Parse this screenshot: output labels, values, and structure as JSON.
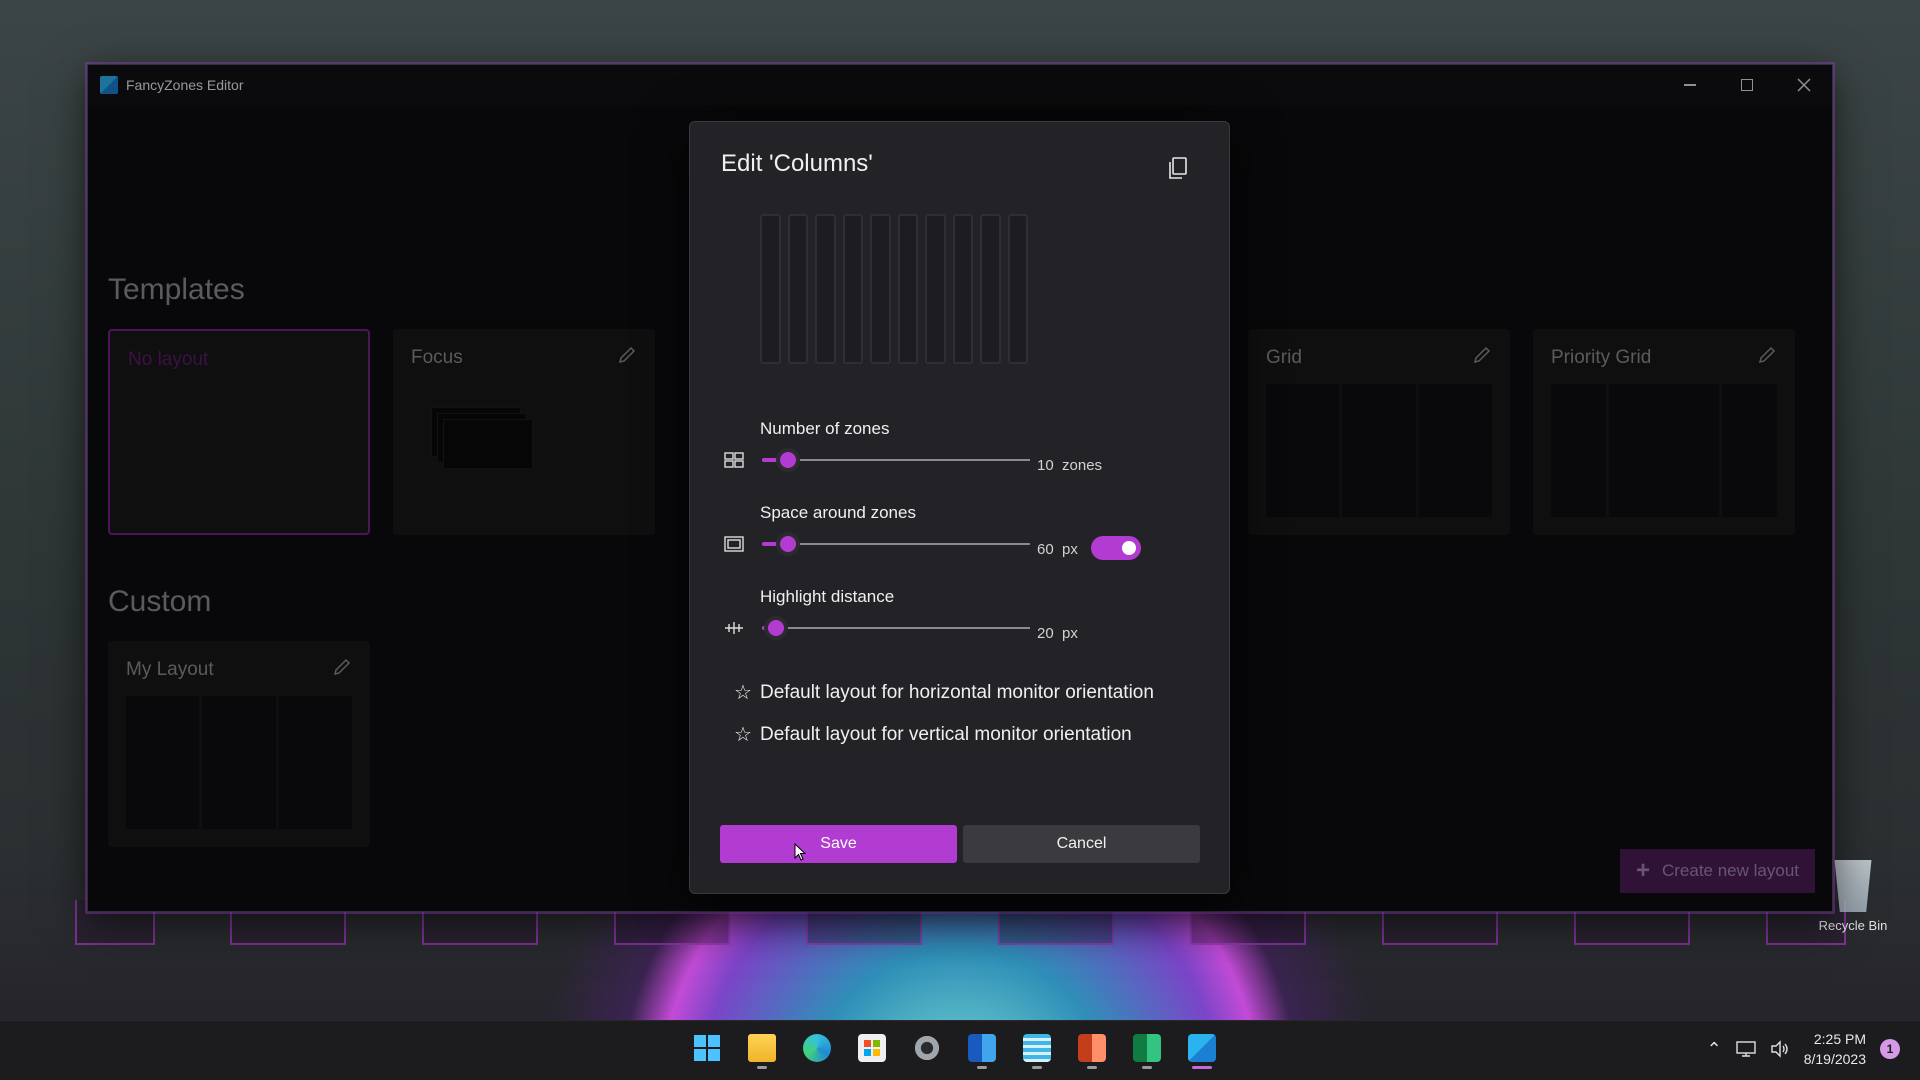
{
  "window": {
    "title": "FancyZones Editor"
  },
  "templates": {
    "heading": "Templates",
    "cards": [
      {
        "label": "No layout"
      },
      {
        "label": "Focus"
      },
      {
        "label": "Grid"
      },
      {
        "label": "Priority Grid"
      }
    ]
  },
  "custom": {
    "heading": "Custom",
    "cards": [
      {
        "label": "My Layout"
      }
    ]
  },
  "create_button_label": "Create new layout",
  "recycle_bin_label": "Recycle Bin",
  "dialog": {
    "title": "Edit 'Columns'",
    "zone_count_preview": 10,
    "number_of_zones": {
      "label": "Number of zones",
      "value": "10",
      "unit": "zones",
      "min": 1,
      "max": 128
    },
    "space_around_zones": {
      "label": "Space around zones",
      "value": "60",
      "unit": "px",
      "enabled": true
    },
    "highlight_distance": {
      "label": "Highlight distance",
      "value": "20",
      "unit": "px"
    },
    "default_horizontal": "Default layout for horizontal monitor orientation",
    "default_vertical": "Default layout for vertical monitor orientation",
    "save_label": "Save",
    "cancel_label": "Cancel"
  },
  "taskbar": {
    "time": "2:25 PM",
    "date": "8/19/2023",
    "notification_count": "1",
    "icons": [
      "start-icon",
      "file-explorer-icon",
      "edge-icon",
      "store-icon",
      "settings-icon",
      "word-icon",
      "notepad-icon",
      "powerpoint-icon",
      "excel-icon",
      "powertoys-icon"
    ]
  },
  "colors": {
    "accent": "#b23bd2",
    "window_bg": "#0d0c0f",
    "dialog_bg": "#232226"
  }
}
